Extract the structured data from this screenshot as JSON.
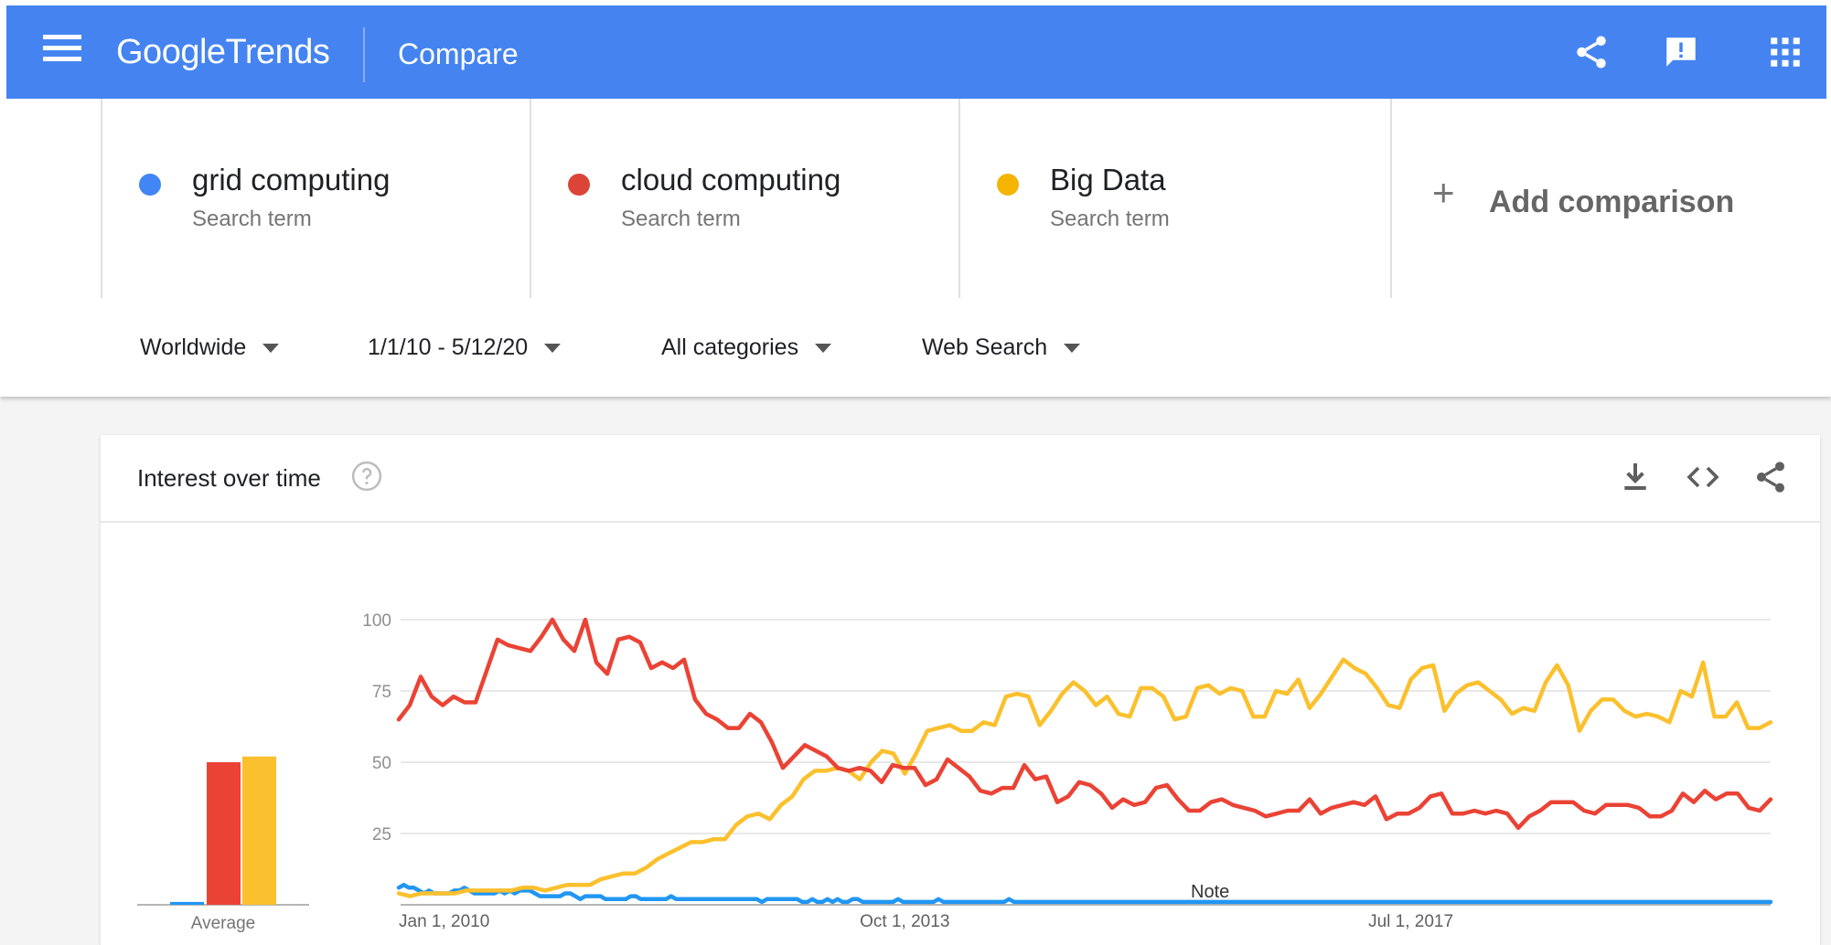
{
  "header": {
    "logo_google": "Google",
    "logo_trends": "Trends",
    "title": "Compare"
  },
  "terms": [
    {
      "name": "grid computing",
      "subtitle": "Search term",
      "color": "#4285f4"
    },
    {
      "name": "cloud computing",
      "subtitle": "Search term",
      "color": "#db4437"
    },
    {
      "name": "Big Data",
      "subtitle": "Search term",
      "color": "#f4b400"
    }
  ],
  "add_comparison": {
    "plus": "+",
    "label": "Add comparison"
  },
  "filters": {
    "region": "Worldwide",
    "date_range": "1/1/10 - 5/12/20",
    "category": "All categories",
    "search_type": "Web Search"
  },
  "card": {
    "title": "Interest over time",
    "note": "Note",
    "average_label": "Average"
  },
  "chart_data": {
    "type": "line",
    "title": "Interest over time",
    "x_tick_labels": [
      "Jan 1, 2010",
      "Oct 1, 2013",
      "Jul 1, 2017"
    ],
    "y_ticks": [
      25,
      50,
      75,
      100
    ],
    "ylim": [
      0,
      100
    ],
    "grid": true,
    "x_range": [
      "2010-01",
      "2020-05"
    ],
    "x_step": "month",
    "averages": {
      "grid computing": 1,
      "cloud computing": 50,
      "Big Data": 52
    },
    "series": [
      {
        "name": "grid computing",
        "color": "#2196f3",
        "values": [
          6,
          7,
          6,
          6,
          5,
          4,
          5,
          4,
          4,
          4,
          4,
          5,
          5,
          6,
          5,
          4,
          4,
          4,
          4,
          4,
          5,
          4,
          5,
          4,
          5,
          5,
          5,
          4,
          3,
          3,
          3,
          3,
          3,
          4,
          4,
          3,
          2,
          3,
          3,
          3,
          3,
          2,
          2,
          2,
          2,
          2,
          3,
          3,
          2,
          2,
          2,
          2,
          2,
          2,
          3,
          2,
          2,
          2,
          2,
          2,
          2,
          2,
          2,
          2,
          2,
          2,
          2,
          2,
          2,
          2,
          2,
          2,
          1,
          2,
          2,
          2,
          2,
          2,
          2,
          2,
          1,
          1,
          2,
          1,
          1,
          2,
          1,
          2,
          1,
          1,
          2,
          2,
          1,
          1,
          1,
          1,
          1,
          1,
          1,
          2,
          1,
          1,
          1,
          1,
          1,
          1,
          1,
          2,
          1,
          1,
          1,
          1,
          1,
          1,
          1,
          1,
          1,
          1,
          1,
          1,
          1,
          2,
          1,
          1,
          1,
          1,
          1,
          1,
          1,
          1,
          1,
          1,
          1,
          1,
          1,
          1,
          1,
          1,
          1,
          1,
          1,
          1,
          1,
          1,
          1,
          1,
          1,
          1,
          1,
          1,
          1,
          1,
          1,
          1,
          1,
          1,
          1,
          1,
          1,
          1,
          1,
          1,
          1,
          1,
          1,
          1,
          1,
          1,
          1,
          1,
          1,
          1,
          1,
          1,
          1,
          1,
          1,
          1,
          1,
          1,
          1,
          1,
          1,
          1,
          1,
          1,
          1,
          1,
          1,
          1,
          1,
          1,
          1,
          1,
          1,
          1,
          1,
          1,
          1,
          1,
          1,
          1,
          1,
          1,
          1,
          1,
          1,
          1,
          1,
          1,
          1,
          1,
          1,
          1,
          1,
          1,
          1,
          1,
          1,
          1,
          1,
          1,
          1,
          1,
          1,
          1,
          1,
          1,
          1,
          1,
          1,
          1,
          1,
          1,
          1,
          1,
          1,
          1,
          1,
          1,
          1,
          1,
          1,
          1,
          1,
          1,
          1,
          1,
          1,
          1,
          1,
          1,
          1,
          1,
          1,
          1,
          1,
          1,
          1,
          1,
          1,
          1,
          1,
          1,
          1,
          1,
          1,
          1,
          1,
          1,
          1,
          1,
          1
        ]
      },
      {
        "name": "cloud computing",
        "color": "#ea4335",
        "values": [
          65,
          70,
          80,
          73,
          70,
          73,
          71,
          71,
          82,
          93,
          91,
          90,
          89,
          94,
          100,
          93,
          89,
          100,
          85,
          81,
          93,
          94,
          92,
          83,
          85,
          83,
          86,
          72,
          67,
          65,
          62,
          62,
          67,
          64,
          57,
          48,
          52,
          56,
          54,
          52,
          48,
          47,
          48,
          47,
          43,
          49,
          48,
          48,
          42,
          44,
          51,
          48,
          45,
          40,
          39,
          41,
          41,
          49,
          44,
          45,
          36,
          38,
          43,
          42,
          39,
          34,
          37,
          35,
          36,
          41,
          42,
          37,
          33,
          33,
          36,
          37,
          35,
          34,
          33,
          31,
          32,
          33,
          33,
          37,
          32,
          34,
          35,
          36,
          35,
          38,
          30,
          32,
          32,
          34,
          38,
          39,
          32,
          32,
          33,
          32,
          33,
          32,
          27,
          31,
          33,
          36,
          36,
          36,
          33,
          32,
          35,
          35,
          35,
          34,
          31,
          31,
          33,
          39,
          36,
          40,
          37,
          39,
          39,
          34,
          33,
          37
        ]
      },
      {
        "name": "Big Data",
        "color": "#fbc02d",
        "values": [
          4,
          3,
          4,
          4,
          4,
          4,
          5,
          5,
          5,
          5,
          5,
          6,
          6,
          5,
          6,
          7,
          7,
          7,
          9,
          10,
          11,
          11,
          13,
          16,
          18,
          20,
          22,
          22,
          23,
          23,
          28,
          31,
          32,
          30,
          35,
          38,
          44,
          47,
          47,
          48,
          47,
          44,
          50,
          54,
          53,
          46,
          53,
          61,
          62,
          63,
          61,
          61,
          64,
          63,
          73,
          74,
          73,
          63,
          68,
          74,
          78,
          75,
          70,
          73,
          67,
          66,
          76,
          76,
          73,
          65,
          66,
          76,
          77,
          74,
          76,
          75,
          66,
          66,
          75,
          74,
          79,
          69,
          74,
          80,
          86,
          83,
          81,
          76,
          70,
          69,
          79,
          83,
          84,
          68,
          74,
          77,
          78,
          75,
          72,
          67,
          69,
          68,
          78,
          84,
          77,
          61,
          68,
          72,
          72,
          68,
          66,
          67,
          66,
          64,
          75,
          73,
          85,
          66,
          66,
          71,
          62,
          62,
          64
        ]
      }
    ]
  },
  "colors": {
    "appbar": "#4584f0",
    "gridline": "#e0e0e0"
  },
  "icons": [
    "menu-icon",
    "share-icon",
    "feedback-icon",
    "apps-grid-icon",
    "help-icon",
    "download-icon",
    "embed-code-icon",
    "share-icon"
  ]
}
